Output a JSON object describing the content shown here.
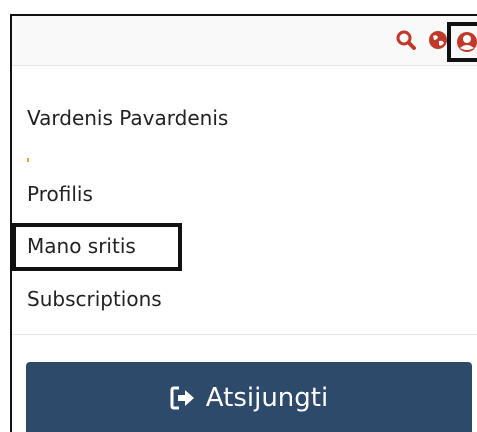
{
  "header": {
    "icons": [
      "search-icon",
      "globe-icon",
      "user-icon"
    ],
    "accent_color": "#c0392b"
  },
  "user": {
    "name": "Vardenis Pavardenis"
  },
  "menu": {
    "items": [
      {
        "label": "Profilis"
      },
      {
        "label": "Mano sritis"
      },
      {
        "label": "Subscriptions"
      }
    ]
  },
  "logout": {
    "label": "Atsijungti",
    "icon": "sign-out-icon",
    "background": "#2d4a6b"
  }
}
